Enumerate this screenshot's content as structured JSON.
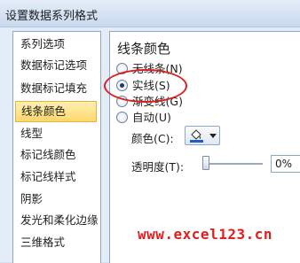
{
  "window": {
    "title": "设置数据系列格式"
  },
  "sidebar": {
    "items": [
      {
        "label": "系列选项"
      },
      {
        "label": "数据标记选项"
      },
      {
        "label": "数据标记填充"
      },
      {
        "label": "线条颜色",
        "selected": true
      },
      {
        "label": "线型"
      },
      {
        "label": "标记线颜色"
      },
      {
        "label": "标记线样式"
      },
      {
        "label": "阴影"
      },
      {
        "label": "发光和柔化边缘"
      },
      {
        "label": "三维格式"
      }
    ]
  },
  "panel": {
    "heading": "线条颜色",
    "options": [
      {
        "label": "无线条(N)",
        "checked": false
      },
      {
        "label": "实线(S)",
        "checked": true
      },
      {
        "label": "渐变线(G)",
        "checked": false
      },
      {
        "label": "自动(U)",
        "checked": false
      }
    ],
    "color_label": "颜色(C):",
    "color_swatch": "#1f5fbf",
    "transparency_label": "透明度(T):",
    "transparency_value": "0%",
    "transparency_fraction": 0
  },
  "annotation": {
    "color": "#d92020"
  },
  "watermark": {
    "text": "www.excel123.cn",
    "color": "#e11d1d"
  }
}
